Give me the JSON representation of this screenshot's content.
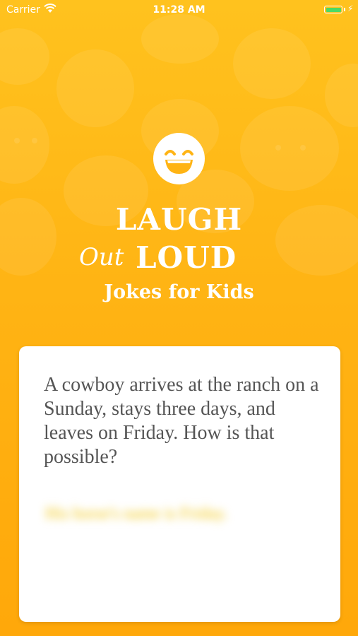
{
  "status_bar": {
    "carrier": "Carrier",
    "time": "11:28 AM",
    "battery_level": 1.0,
    "battery_color": "#4CD964",
    "wifi_icon": "wifi-icon",
    "charging_icon": "bolt-icon"
  },
  "header": {
    "logo_icon": "laughing-face-icon",
    "title_line1": "LAUGH",
    "title_out": "Out",
    "title_loud": "LOUD",
    "subtitle": "Jokes for Kids"
  },
  "joke_card": {
    "question": "A cowboy arrives at the ranch on a Sunday, stays three days, and leaves on Friday. How is that possible?",
    "answer": "His horse's name is Friday."
  },
  "colors": {
    "background_top": "#FFC21E",
    "background_bottom": "#FFA80A",
    "text_on_background": "#ffffff",
    "question_text": "#555555",
    "answer_text": "#f0c200"
  }
}
